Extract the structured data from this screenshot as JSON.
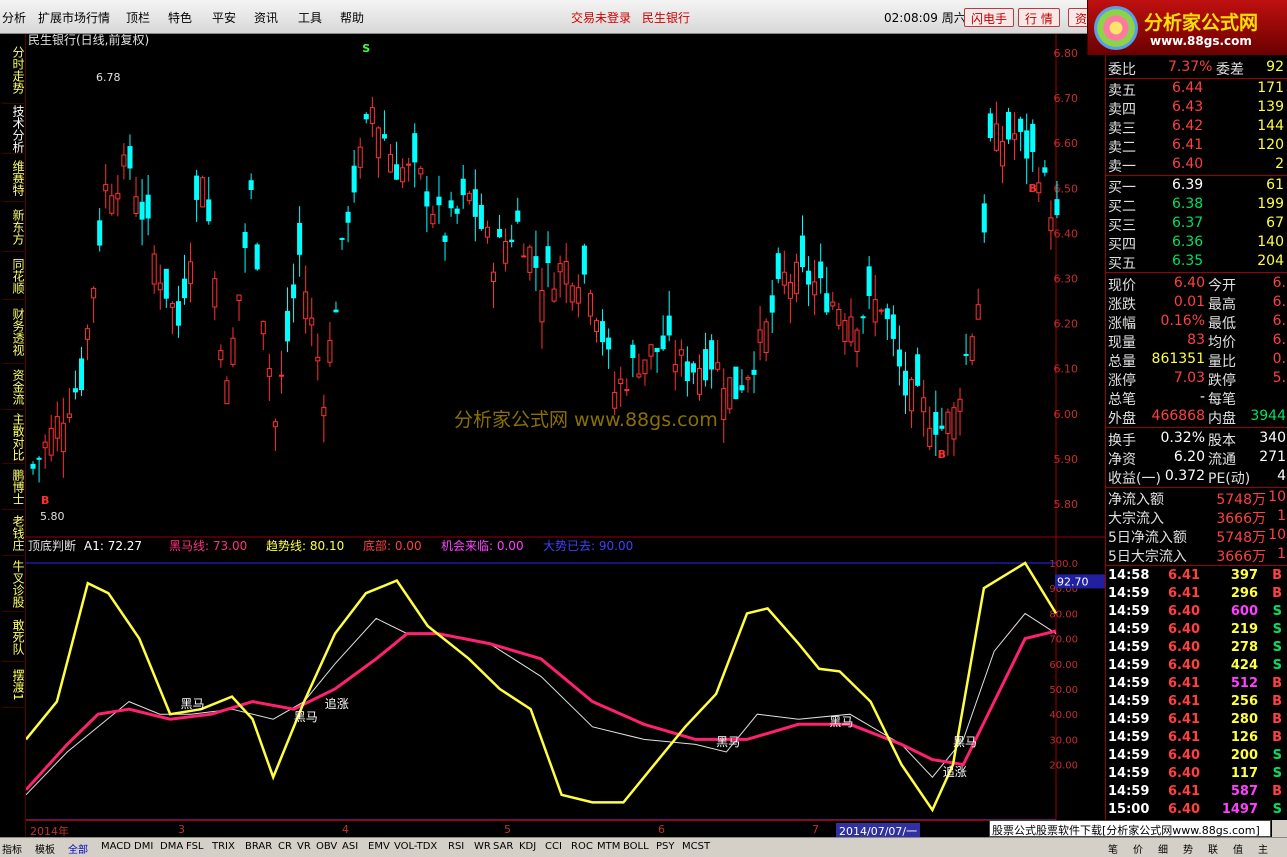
{
  "menu": {
    "items": [
      "分析",
      "扩展市场行情",
      "顶栏",
      "特色",
      "平安",
      "资讯",
      "工具",
      "帮助"
    ],
    "login_status": "交易未登录",
    "stock_name": "民生银行",
    "clock": "02:08:09 周六",
    "btn_flash": "闪电手",
    "btn_quote": "行 情",
    "btn_info": "资"
  },
  "logo": {
    "title": "分析家公式网",
    "url": "www.88gs.com"
  },
  "left_tabs": [
    {
      "label": "分时走势",
      "active": false
    },
    {
      "label": "技术分析",
      "active": true
    },
    {
      "label": "维赛特",
      "active": false
    },
    {
      "label": "新东方",
      "active": false
    },
    {
      "label": "同花顺",
      "active": false
    },
    {
      "label": "财务透视",
      "active": false
    },
    {
      "label": "资金流",
      "active": false
    },
    {
      "label": "主散对比",
      "active": false
    },
    {
      "label": "鹏博士",
      "active": false
    },
    {
      "label": "老钱庄",
      "active": false
    },
    {
      "label": "牛叉诊股",
      "active": false
    },
    {
      "label": "敢死队",
      "active": false
    },
    {
      "label": "摆渡1",
      "active": false
    }
  ],
  "main_chart": {
    "title": "民生银行(日线,前复权)",
    "high_label": "6.78",
    "low_label": "5.80",
    "watermark": "分析家公式网 www.88gs.com",
    "y_ticks": [
      "6.80",
      "6.70",
      "6.60",
      "6.50",
      "6.40",
      "6.30",
      "6.20",
      "6.10",
      "6.00",
      "5.90",
      "5.80"
    ],
    "y_min": 5.76,
    "y_max": 6.82,
    "markers": [
      {
        "type": "B",
        "index": 2
      },
      {
        "type": "S",
        "index": 55
      },
      {
        "type": "B",
        "index": 150
      },
      {
        "type": "B",
        "index": 165
      }
    ]
  },
  "indicator": {
    "name": "顶底判断",
    "values": [
      {
        "label": "A1:",
        "value": "72.27",
        "color": "#ffffff"
      },
      {
        "label": "黑马线:",
        "value": "73.00",
        "color": "#ff3080"
      },
      {
        "label": "趋势线:",
        "value": "80.10",
        "color": "#ffff40"
      },
      {
        "label": "底部:",
        "value": "0.00",
        "color": "#ff4040"
      },
      {
        "label": "机会来临:",
        "value": "0.00",
        "color": "#ff40ff"
      },
      {
        "label": "大势已去:",
        "value": "90.00",
        "color": "#4040ff"
      }
    ],
    "current_value": "92.70",
    "y_ticks": [
      "100.0",
      "90.00",
      "80.00",
      "70.00",
      "60.00",
      "50.00",
      "40.00",
      "30.00",
      "20.00"
    ],
    "annotations": [
      "黑马",
      "黑马",
      "追涨",
      "黑马",
      "黑马",
      "追涨",
      "黑马"
    ]
  },
  "dates": [
    "2014年",
    "3",
    "4",
    "5",
    "6",
    "7",
    "2014/07/07/一"
  ],
  "quote": {
    "weibi_label": "委比",
    "weibi": "7.37%",
    "weicha_label": "委差",
    "weicha": "92",
    "asks": [
      {
        "label": "卖五",
        "price": "6.44",
        "vol": "171"
      },
      {
        "label": "卖四",
        "price": "6.43",
        "vol": "139"
      },
      {
        "label": "卖三",
        "price": "6.42",
        "vol": "144"
      },
      {
        "label": "卖二",
        "price": "6.41",
        "vol": "120"
      },
      {
        "label": "卖一",
        "price": "6.40",
        "vol": "2"
      }
    ],
    "bids": [
      {
        "label": "买一",
        "price": "6.39",
        "vol": "61"
      },
      {
        "label": "买二",
        "price": "6.38",
        "vol": "199"
      },
      {
        "label": "买三",
        "price": "6.37",
        "vol": "67"
      },
      {
        "label": "买四",
        "price": "6.36",
        "vol": "140"
      },
      {
        "label": "买五",
        "price": "6.35",
        "vol": "204"
      }
    ],
    "stats": [
      {
        "l1": "现价",
        "v1": "6.40",
        "c1": "red",
        "l2": "今开",
        "v2": "6."
      },
      {
        "l1": "涨跌",
        "v1": "0.01",
        "c1": "red",
        "l2": "最高",
        "v2": "6."
      },
      {
        "l1": "涨幅",
        "v1": "0.16%",
        "c1": "red",
        "l2": "最低",
        "v2": "6."
      },
      {
        "l1": "现量",
        "v1": "83",
        "c1": "red",
        "l2": "均价",
        "v2": "6."
      },
      {
        "l1": "总量",
        "v1": "861351",
        "c1": "yel",
        "l2": "量比",
        "v2": "0."
      },
      {
        "l1": "涨停",
        "v1": "7.03",
        "c1": "red",
        "l2": "跌停",
        "v2": "5."
      },
      {
        "l1": "总笔",
        "v1": "-",
        "c1": "wht",
        "l2": "每笔",
        "v2": ""
      },
      {
        "l1": "外盘",
        "v1": "466868",
        "c1": "red",
        "l2": "内盘",
        "v2": "3944"
      }
    ],
    "stats2": [
      {
        "l1": "换手",
        "v1": "0.32%",
        "l2": "股本",
        "v2": "340"
      },
      {
        "l1": "净资",
        "v1": "6.20",
        "l2": "流通",
        "v2": "271"
      },
      {
        "l1": "收益(一)",
        "v1": "0.372",
        "l2": "PE(动)",
        "v2": "4"
      }
    ],
    "flows": [
      {
        "label": "净流入额",
        "value": "5748万",
        "extra": "10"
      },
      {
        "label": "大宗流入",
        "value": "3666万",
        "extra": "1"
      },
      {
        "label": "5日净流入额",
        "value": "5748万",
        "extra": "10"
      },
      {
        "label": "5日大宗流入",
        "value": "3666万",
        "extra": "1"
      }
    ],
    "ticks": [
      {
        "time": "14:58",
        "price": "6.41",
        "vol": "397",
        "bs": "B"
      },
      {
        "time": "14:59",
        "price": "6.41",
        "vol": "296",
        "bs": "B"
      },
      {
        "time": "14:59",
        "price": "6.40",
        "vol": "600",
        "bs": "S"
      },
      {
        "time": "14:59",
        "price": "6.40",
        "vol": "219",
        "bs": "S"
      },
      {
        "time": "14:59",
        "price": "6.40",
        "vol": "278",
        "bs": "S"
      },
      {
        "time": "14:59",
        "price": "6.40",
        "vol": "424",
        "bs": "S"
      },
      {
        "time": "14:59",
        "price": "6.41",
        "vol": "512",
        "bs": "B"
      },
      {
        "time": "14:59",
        "price": "6.41",
        "vol": "256",
        "bs": "B"
      },
      {
        "time": "14:59",
        "price": "6.41",
        "vol": "280",
        "bs": "B"
      },
      {
        "time": "14:59",
        "price": "6.41",
        "vol": "126",
        "bs": "B"
      },
      {
        "time": "14:59",
        "price": "6.40",
        "vol": "200",
        "bs": "S"
      },
      {
        "time": "14:59",
        "price": "6.40",
        "vol": "117",
        "bs": "S"
      },
      {
        "time": "14:59",
        "price": "6.41",
        "vol": "587",
        "bs": "B"
      },
      {
        "time": "15:00",
        "price": "6.40",
        "vol": "1497",
        "bs": "S"
      }
    ]
  },
  "bottom_tabs": [
    "指标",
    "模板",
    "全部",
    "MACD",
    "DMI",
    "DMA",
    "FSL",
    "TRIX",
    "BRAR",
    "CR",
    "VR",
    "OBV",
    "ASI",
    "EMV",
    "VOL-TDX",
    "RSI",
    "WR",
    "SAR",
    "KDJ",
    "CCI",
    "ROC",
    "MTM",
    "BOLL",
    "PSY",
    "MCST"
  ],
  "right_bottom_tabs": [
    "笔",
    "价",
    "细",
    "势",
    "联",
    "值",
    "主"
  ],
  "ad_text": "股票公式股票软件下载[分析家公式网www.88gs.com]"
}
